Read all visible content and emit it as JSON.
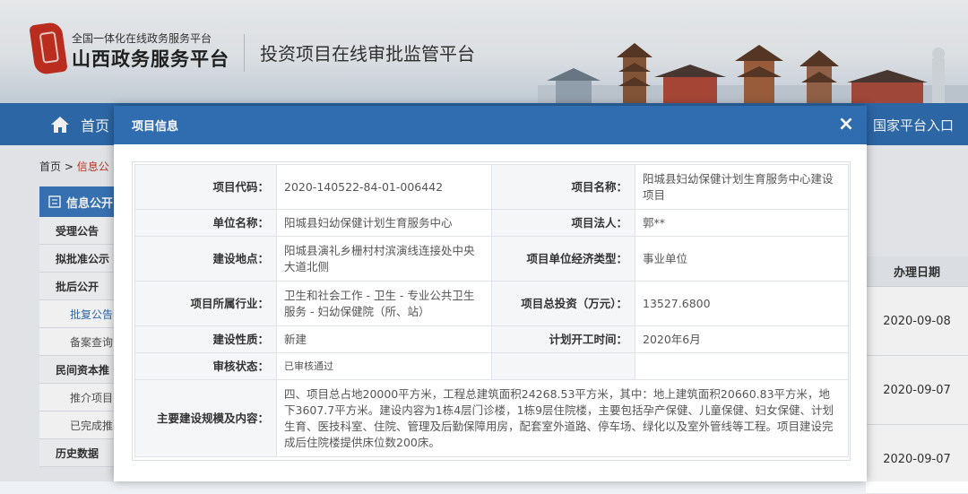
{
  "header": {
    "logo_sub": "全国一体化在线政务服务平台",
    "logo_main": "山西政务服务平台",
    "site_title": "投资项目在线审批监管平台"
  },
  "nav": {
    "home_label": "首页",
    "right_label": "国家平台入口"
  },
  "breadcrumb": {
    "home": "首页",
    "sep": ">",
    "current": "信息公"
  },
  "sidebar": {
    "head": "信息公开",
    "items": [
      {
        "label": "受理公告",
        "type": "main"
      },
      {
        "label": "拟批准公示",
        "type": "main"
      },
      {
        "label": "批后公开",
        "type": "main"
      },
      {
        "label": "批复公告",
        "type": "sub-active"
      },
      {
        "label": "备案查询",
        "type": "sub"
      },
      {
        "label": "民间资本推",
        "type": "main"
      },
      {
        "label": "推介项目",
        "type": "sub"
      },
      {
        "label": "已完成推",
        "type": "sub"
      },
      {
        "label": "历史数据",
        "type": "main"
      }
    ]
  },
  "list": {
    "date_header": "办理日期",
    "dates": [
      "2020-09-08",
      "2020-09-07",
      "2020-09-07"
    ]
  },
  "modal": {
    "title": "项目信息",
    "close": "×",
    "rows": {
      "code_label": "项目代码：",
      "code_value": "2020-140522-84-01-006442",
      "name_label": "项目名称：",
      "name_value": "阳城县妇幼保健计划生育服务中心建设项目",
      "unit_label": "单位名称：",
      "unit_value": "阳城县妇幼保健计划生育服务中心",
      "legal_label": "项目法人：",
      "legal_value": "郭**",
      "site_label": "建设地点：",
      "site_value": "阳城县演礼乡栅村村滨演线连接处中央大道北侧",
      "econ_label": "项目单位经济类型：",
      "econ_value": "事业单位",
      "industry_label": "项目所属行业：",
      "industry_value": "卫生和社会工作 - 卫生 - 专业公共卫生服务 - 妇幼保健院（所、站）",
      "invest_label": "项目总投资（万元）：",
      "invest_value": "13527.6800",
      "nature_label": "建设性质：",
      "nature_value": "新建",
      "start_label": "计划开工时间：",
      "start_value": "2020年6月",
      "audit_label": "审核状态：",
      "audit_value": "已审核通过",
      "scale_label": "主要建设规模及内容：",
      "scale_value": "四、项目总占地20000平方米，工程总建筑面积24268.53平方米，其中：地上建筑面积20660.83平方米，地下3607.7平方米。建设内容为1栋4层门诊楼，1栋9层住院楼，主要包括孕产保健、儿童保健、妇女保健、计划生育、医技科室、住院、管理及后勤保障用房，配套室外道路、停车场、绿化以及室外管线等工程。项目建设完成后住院楼提供床位数200床。"
    }
  },
  "colors": {
    "primary": "#2f6db0",
    "label_bg": "#f4f6f8",
    "logo_red": "#c62f1f"
  }
}
